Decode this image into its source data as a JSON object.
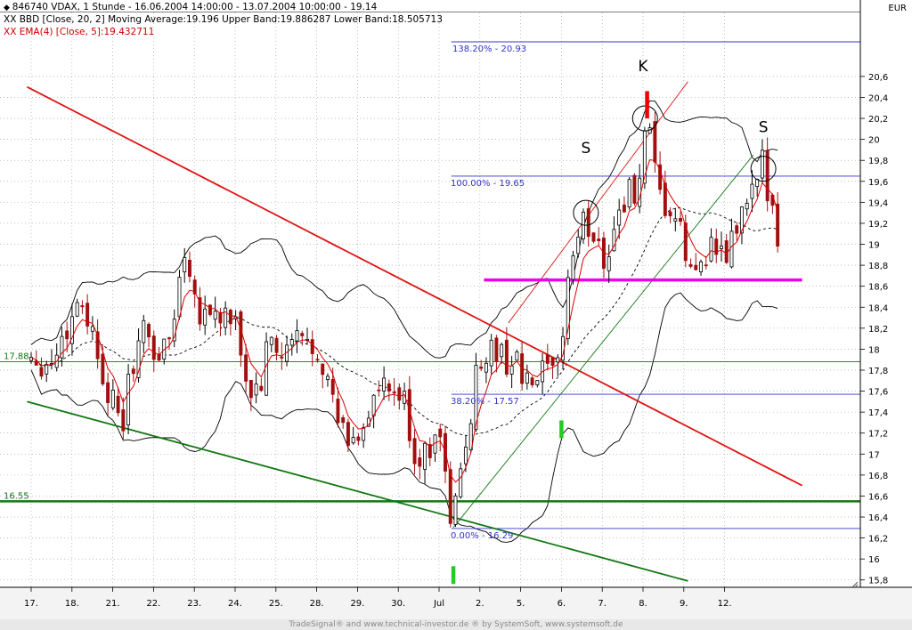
{
  "header": {
    "line1": "846740  VDAX, 1 Stunde - 16.06.2004 14:00:00 - 13.07.2004 10:00:00 - 19.14",
    "line2": "XX BBD [Close, 20, 2] Moving Average:19.196 Upper Band:19.886287 Lower Band:18.505713",
    "line3": "XX EMA(4) [Close, 5]:19.432711"
  },
  "currency": "EUR",
  "footer": "TradeSignal® and www.technical-investor.de ® by SystemSoft, www.systemsoft.de",
  "colors": {
    "candle_up": "#000000",
    "candle_down": "#a01010",
    "ema": "#dd0000",
    "bands": "#000000",
    "downtrend": "#e01515",
    "uptrend_support": "#117711",
    "neckline": "#ee00ee",
    "fibonacci": "#3333cc",
    "low_marker": "#22cc22",
    "high_marker": "#ee0000",
    "support_16_55": "#117711"
  },
  "chart_data": {
    "type": "candlestick",
    "x_ticks": [
      "17.",
      "18.",
      "21.",
      "22.",
      "23.",
      "24.",
      "25.",
      "28.",
      "29.",
      "30.",
      "Jul",
      "2.",
      "5.",
      "6.",
      "7.",
      "8.",
      "9.",
      "12."
    ],
    "y_ticks": [
      15.8,
      16,
      16.2,
      16.4,
      16.6,
      16.8,
      17,
      17.2,
      17.4,
      17.6,
      17.8,
      18,
      18.2,
      18.4,
      18.6,
      18.8,
      19,
      19.2,
      19.4,
      19.6,
      19.8,
      20,
      20.2,
      20.4,
      20.6
    ],
    "ylim": [
      15.73,
      21.21
    ],
    "session_count": 18.7,
    "last_close": 19.14,
    "moving_average": 19.196,
    "upper_band": 19.886287,
    "lower_band": 18.505713,
    "ema": 19.432711,
    "price_path": [
      [
        0,
        17.95
      ],
      [
        0.45,
        17.85
      ],
      [
        0.7,
        18.05
      ],
      [
        1.0,
        18.3
      ],
      [
        1.2,
        18.55
      ],
      [
        1.5,
        18.15
      ],
      [
        1.9,
        17.6
      ],
      [
        2.2,
        17.2
      ],
      [
        2.5,
        17.9
      ],
      [
        2.8,
        18.2
      ],
      [
        3.1,
        17.9
      ],
      [
        3.4,
        18.1
      ],
      [
        3.8,
        19.05
      ],
      [
        4.05,
        18.4
      ],
      [
        4.45,
        18.35
      ],
      [
        4.8,
        18.3
      ],
      [
        5.1,
        18.1
      ],
      [
        5.3,
        17.6
      ],
      [
        5.6,
        17.6
      ],
      [
        5.85,
        18.1
      ],
      [
        6.15,
        17.9
      ],
      [
        6.5,
        18.1
      ],
      [
        6.75,
        18.05
      ],
      [
        7.1,
        18.0
      ],
      [
        7.3,
        17.6
      ],
      [
        7.6,
        17.2
      ],
      [
        7.9,
        17.1
      ],
      [
        8.2,
        17.35
      ],
      [
        8.5,
        17.6
      ],
      [
        8.8,
        17.55
      ],
      [
        9.1,
        17.55
      ],
      [
        9.4,
        17.0
      ],
      [
        9.7,
        16.95
      ],
      [
        9.95,
        17.4
      ],
      [
        10.1,
        16.9
      ],
      [
        10.3,
        16.35
      ],
      [
        10.55,
        16.8
      ],
      [
        10.8,
        17.5
      ],
      [
        11.0,
        17.9
      ],
      [
        11.25,
        18.0
      ],
      [
        11.6,
        17.9
      ],
      [
        11.9,
        17.9
      ],
      [
        12.1,
        17.6
      ],
      [
        12.4,
        17.7
      ],
      [
        12.7,
        17.8
      ],
      [
        12.85,
        17.6
      ],
      [
        13.0,
        18.1
      ],
      [
        13.2,
        18.8
      ],
      [
        13.5,
        19.2
      ],
      [
        13.8,
        19.1
      ],
      [
        14.1,
        18.85
      ],
      [
        14.3,
        19.2
      ],
      [
        14.6,
        19.5
      ],
      [
        14.85,
        19.45
      ],
      [
        15.0,
        19.9
      ],
      [
        15.12,
        20.1
      ],
      [
        15.25,
        19.7
      ],
      [
        15.45,
        19.35
      ],
      [
        15.7,
        19.3
      ],
      [
        15.9,
        19.1
      ],
      [
        16.05,
        18.9
      ],
      [
        16.2,
        18.65
      ],
      [
        16.4,
        18.85
      ],
      [
        16.6,
        19.0
      ],
      [
        16.8,
        18.95
      ],
      [
        16.95,
        18.8
      ],
      [
        17.15,
        19.0
      ],
      [
        17.4,
        19.25
      ],
      [
        17.6,
        19.45
      ],
      [
        17.8,
        19.5
      ],
      [
        17.92,
        19.75
      ],
      [
        18.0,
        19.6
      ],
      [
        18.15,
        19.5
      ],
      [
        18.3,
        19.14
      ]
    ],
    "trendlines": {
      "downtrend": {
        "from": [
          -0.1,
          20.5
        ],
        "to": [
          18.9,
          16.7
        ]
      },
      "lower_trend": {
        "from": [
          -0.1,
          17.5
        ],
        "to": [
          16.1,
          15.79
        ]
      },
      "support_16_55": 16.55,
      "neckline": {
        "from": [
          11.1,
          18.66
        ],
        "to": [
          18.9,
          18.66
        ]
      },
      "level_17_88": 17.88,
      "channel_upper": {
        "from": [
          11.7,
          18.25
        ],
        "to": [
          16.1,
          20.55
        ]
      },
      "channel_lower": {
        "from": [
          10.35,
          16.3
        ],
        "to": [
          17.7,
          19.85
        ]
      }
    },
    "fibonacci": [
      {
        "label": "138.20% - 20.93",
        "value": 20.93
      },
      {
        "label": "100.00% - 19.65",
        "value": 19.65
      },
      {
        "label": "38.20% - 17.57",
        "value": 17.57
      },
      {
        "label": "0.00% - 16.29",
        "value": 16.29
      }
    ],
    "level_labels": [
      {
        "label": "16.55",
        "value": 16.55
      },
      {
        "label": "17.88",
        "value": 17.88
      }
    ],
    "annotations": [
      {
        "text": "S",
        "x": 13.6,
        "y": 19.87
      },
      {
        "text": "K",
        "x": 15.0,
        "y": 20.65
      },
      {
        "text": "S",
        "x": 17.95,
        "y": 20.07
      }
    ],
    "circles": [
      {
        "x": 13.6,
        "y": 19.3
      },
      {
        "x": 15.05,
        "y": 20.2
      },
      {
        "x": 17.95,
        "y": 19.72
      }
    ],
    "markers": [
      {
        "color": "low",
        "x": 10.35,
        "from": 16.05,
        "to": 15.95
      },
      {
        "color": "low",
        "x": 13.0,
        "from": 17.44,
        "to": 17.22
      },
      {
        "color": "high",
        "x": 15.1,
        "from": 20.46,
        "to": 20.2
      }
    ]
  }
}
